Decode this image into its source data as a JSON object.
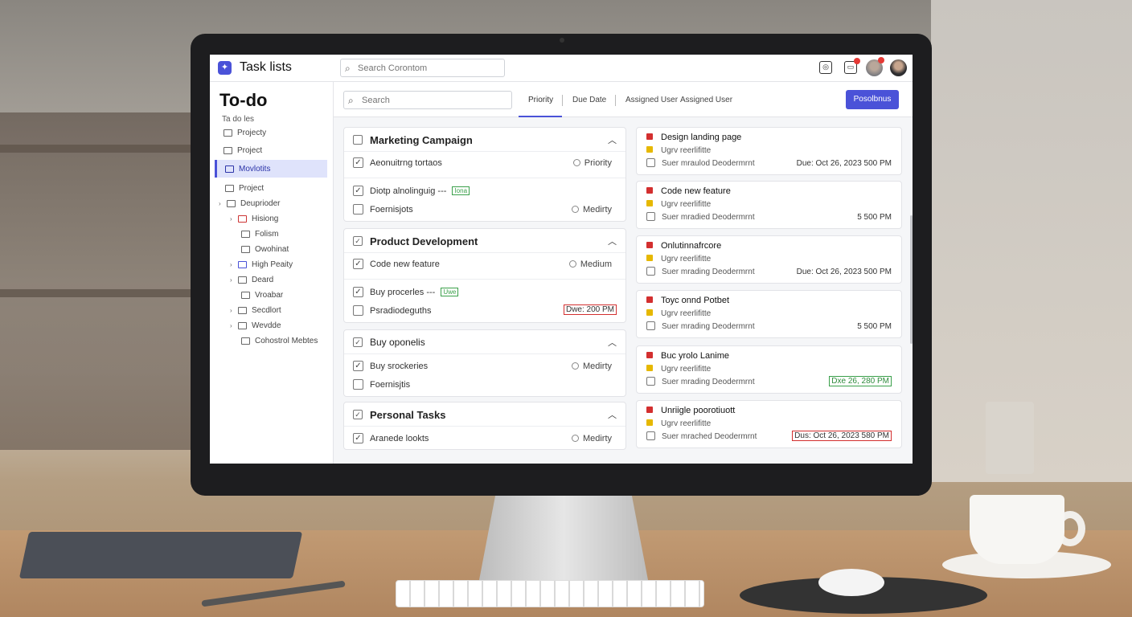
{
  "app": {
    "title": "Task lists",
    "logo_glyph": "✦",
    "accent": "#4a52d8"
  },
  "topbar": {
    "search_placeholder": "Search Corontom"
  },
  "sidebar": {
    "title": "To-do",
    "subtitle": "Ta do les",
    "items": [
      {
        "label": "Projecty"
      },
      {
        "label": "Project"
      },
      {
        "label": "Movlotits"
      },
      {
        "label": "Project"
      },
      {
        "label": "Deuprioder"
      },
      {
        "label": "Hisiong"
      },
      {
        "label": "Folism"
      },
      {
        "label": "Owohinat"
      },
      {
        "label": "High Peaity"
      },
      {
        "label": "Deard"
      },
      {
        "label": "Vroabar"
      },
      {
        "label": "Secdlort"
      },
      {
        "label": "Wevdde"
      },
      {
        "label": "Cohostrol Mebtes"
      }
    ]
  },
  "toolbar": {
    "search_placeholder": "Search",
    "tabs": [
      "Priority",
      "Due Date",
      "Assigned User",
      "Assigned User"
    ],
    "primary_button": "Posolbnus"
  },
  "groups": [
    {
      "title": "Marketing Campaign",
      "rows": [
        {
          "text": "Aeonuitrng tortaos",
          "meta": "Priority"
        },
        {
          "text": "Diotp alnolinguig",
          "tag": "Iona"
        },
        {
          "text": "Foernisjots",
          "meta": "Medirty"
        }
      ]
    },
    {
      "title": "Product Development",
      "rows": [
        {
          "text": "Code new feature",
          "meta": "Medium"
        },
        {
          "text": "Buy procerles",
          "tag": "Uwe"
        },
        {
          "text": "Psradiodeguths",
          "due": "Dwe: 200 PM"
        }
      ]
    },
    {
      "title": "Buy oponelis",
      "rows": [
        {
          "text": "Buy srockeries",
          "meta": "Medirty"
        },
        {
          "text": "Foernisjtis"
        }
      ]
    },
    {
      "title": "Personal Tasks",
      "rows": [
        {
          "text": "Aranede lookts",
          "meta": "Medirty"
        }
      ]
    }
  ],
  "task_cards": [
    {
      "title": "Design landing page",
      "sub": "Ugrv reerlifitte",
      "owner": "Suer mraulod Deodermrnt",
      "due": "Due: Oct 26, 2023  500 PM",
      "due_style": "plain"
    },
    {
      "title": "Code new feature",
      "sub": "Ugrv reerlifitte",
      "owner": "Suer mradied Deodermrnt",
      "due": "5 500 PM",
      "due_style": "plain"
    },
    {
      "title": "Onlutinnafrcore",
      "sub": "Ugrv reerlifitte",
      "owner": "Suer mrading Deodermrnt",
      "due": "Due: Oct 26, 2023  500 PM",
      "due_style": "plain"
    },
    {
      "title": "Toyc onnd Potbet",
      "sub": "Ugrv reerlifitte",
      "owner": "Suer mrading Deodermrnt",
      "due": "5 500 PM",
      "due_style": "plain"
    },
    {
      "title": "Buc yrolo Lanime",
      "sub": "Ugrv reerlifitte",
      "owner": "Suer mrading Deodermrnt",
      "due": "Dxe 26, 280 PM",
      "due_style": "green"
    },
    {
      "title": "Unriigle poorotiuott",
      "sub": "Ugrv reerlifitte",
      "owner": "Suer mrached Deodermrnt",
      "due": "Dus: Oct 26, 2023  580 PM",
      "due_style": "red"
    }
  ]
}
